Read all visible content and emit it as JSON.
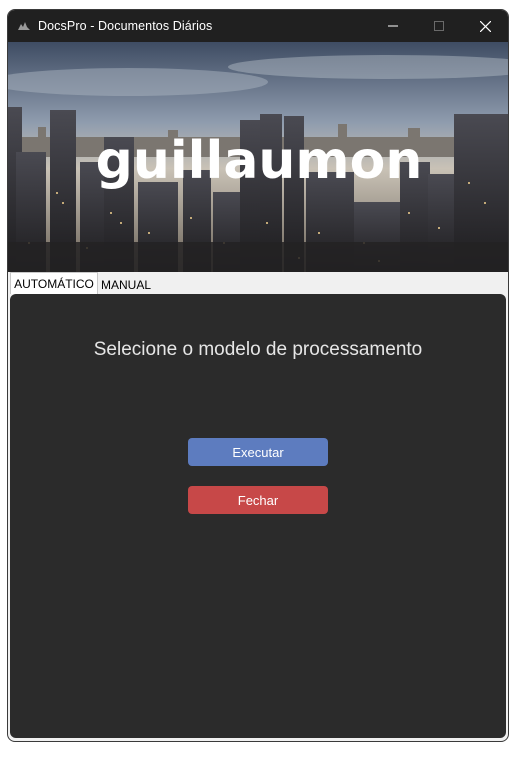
{
  "window": {
    "title": "DocsPro - Documentos Diários",
    "controls": [
      "minimize-icon",
      "maximize-icon",
      "close-icon"
    ]
  },
  "banner": {
    "logo_text": "guillaumon",
    "image": "city-skyline-at-dusk"
  },
  "tabs": [
    {
      "label": "AUTOMÁTICO",
      "active": true
    },
    {
      "label": "MANUAL",
      "active": false
    }
  ],
  "panel": {
    "heading": "Selecione o modelo de processamento",
    "execute_label": "Executar",
    "close_label": "Fechar"
  },
  "colors": {
    "titlebar": "#202020",
    "panel_bg": "#2b2b2b",
    "execute_btn": "#5d7cbf",
    "close_btn": "#c74848"
  }
}
